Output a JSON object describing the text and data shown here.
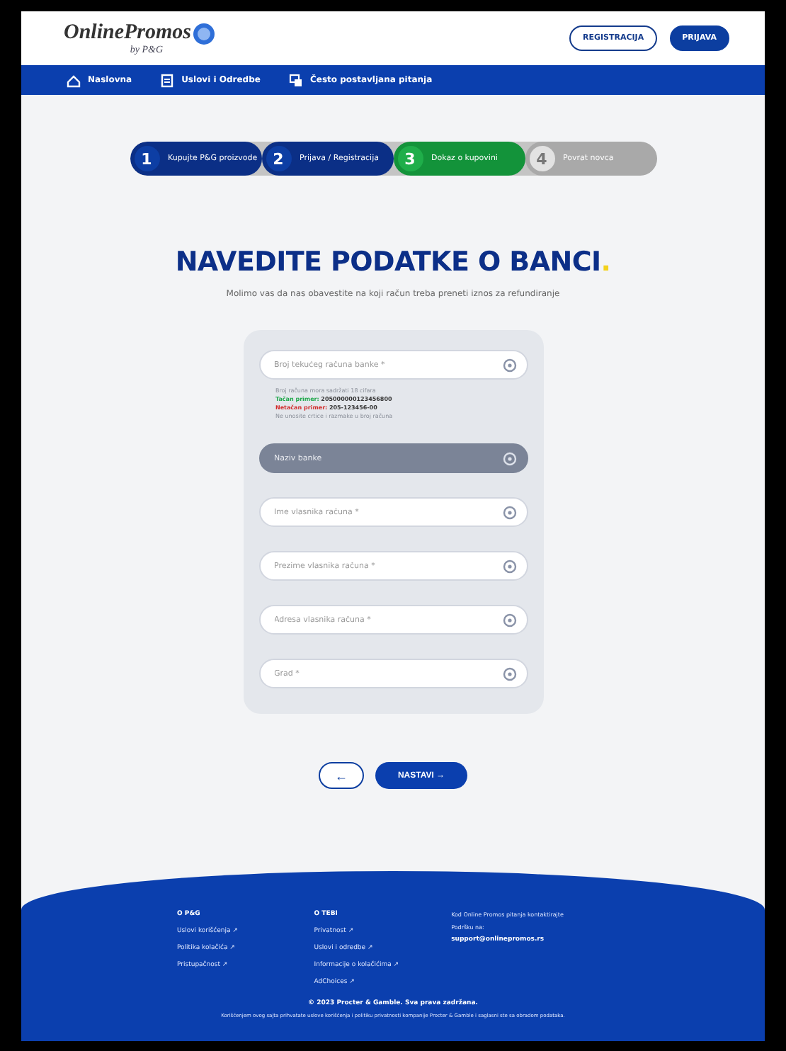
{
  "header": {
    "logo": "OnlinePromos",
    "logo_sub": "by P&G",
    "buttons": [
      {
        "label": "REGISTRACIJA",
        "kind": "outline"
      },
      {
        "label": "PRIJAVA",
        "kind": "filled"
      }
    ]
  },
  "nav": [
    {
      "label": "Naslovna"
    },
    {
      "label": "Uslovi i Odredbe"
    },
    {
      "label": "Često postavljana pitanja"
    }
  ],
  "steps": [
    {
      "number": "1",
      "label": "Kupujte P&G proizvode",
      "done": true,
      "selected": false
    },
    {
      "number": "2",
      "label": "Prijava / Registracija",
      "done": true,
      "selected": false
    },
    {
      "number": "3",
      "label": "Dokaz o kupovini",
      "done": false,
      "selected": true
    },
    {
      "number": "4",
      "label": "Povrat novca",
      "done": false,
      "selected": false
    }
  ],
  "title": "NAVEDITE PODATKE O BANCI",
  "title_dot": ".",
  "subtitle": "Molimo vas da nas obavestite na koji račun treba preneti iznos za refundiranje",
  "fields": [
    {
      "placeholder": "Broj tekućeg računa banke *",
      "disabled": false,
      "hints": [
        {
          "kind": "note",
          "text": "Broj računa mora sadržati 18 cifara"
        },
        {
          "kind": "correct",
          "label": "Tačan primer:",
          "text": "205000000123456800"
        },
        {
          "kind": "wrong",
          "label": "Netačan primer:",
          "text": "205-123456-00"
        },
        {
          "kind": "note",
          "text": "Ne unosite crtice i razmake u broj računa"
        }
      ]
    },
    {
      "placeholder": "Naziv banke",
      "disabled": true
    },
    {
      "placeholder": "Ime vlasnika računa *",
      "disabled": false
    },
    {
      "placeholder": "Prezime vlasnika računa *",
      "disabled": false
    },
    {
      "placeholder": "Adresa vlasnika računa *",
      "disabled": false
    },
    {
      "placeholder": "Grad *",
      "disabled": false
    }
  ],
  "actions": {
    "back": "←",
    "next": "NASTAVI →"
  },
  "footer": {
    "columns": [
      {
        "heading": "O P&G",
        "links": [
          "Uslovi korišćenja ↗",
          "Politika kolačića ↗",
          "Pristupačnost ↗"
        ]
      },
      {
        "heading": "O TEBI",
        "links": [
          "Privatnost ↗",
          "Uslovi i odredbe ↗",
          "Informacije o kolačićima ↗",
          "AdChoices ↗"
        ]
      }
    ],
    "contact": [
      "Kod Online Promos pitanja kontaktirajte",
      "Podršku na:"
    ],
    "email": "support@onlinepromos.rs",
    "copyright": "© 2023 Procter & Gamble. Sva prava zadržana.",
    "fine_print": "Korišćenjem ovog sajta prihvatate uslove korišćenja i politiku privatnosti kompanije Procter & Gamble i saglasni ste sa obradom podataka."
  }
}
